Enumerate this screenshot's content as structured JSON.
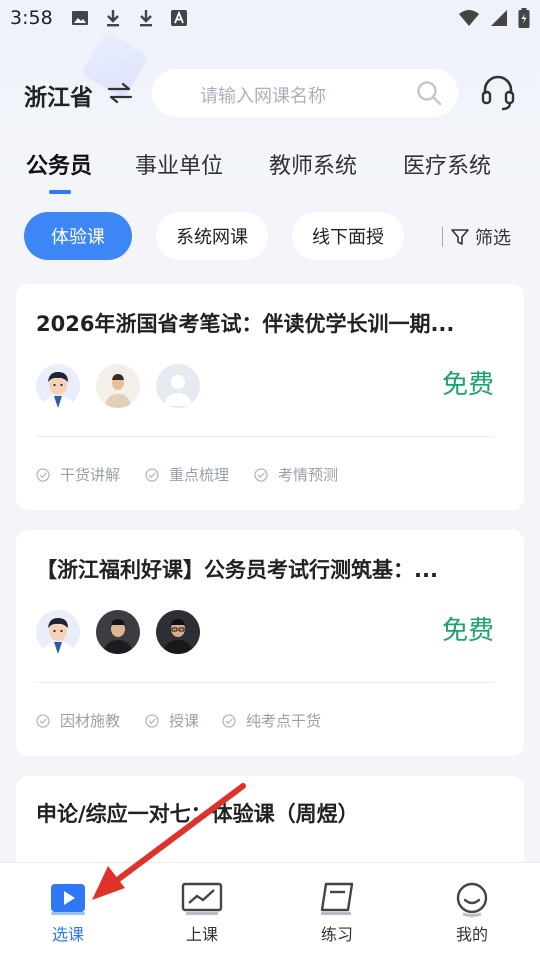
{
  "status_bar": {
    "time": "3:58",
    "notif_icons": [
      "image-icon",
      "download-icon",
      "download-icon",
      "font-icon"
    ]
  },
  "header": {
    "province": "浙江省",
    "search_placeholder": "请输入网课名称"
  },
  "tabs": [
    {
      "label": "公务员",
      "active": true
    },
    {
      "label": "事业单位",
      "active": false
    },
    {
      "label": "教师系统",
      "active": false
    },
    {
      "label": "医疗系统",
      "active": false
    }
  ],
  "chips": [
    {
      "label": "体验课",
      "active": true
    },
    {
      "label": "系统网课",
      "active": false
    },
    {
      "label": "线下面授",
      "active": false
    }
  ],
  "filter_label": "筛选",
  "courses": [
    {
      "title": "2026年浙国省考笔试：伴读优学长训一期...",
      "price": "免费",
      "tags": [
        "干货讲解",
        "重点梳理",
        "考情预测"
      ]
    },
    {
      "title": "【浙江福利好课】公务员考试行测筑基：...",
      "price": "免费",
      "tags": [
        "因材施教",
        "授课",
        "纯考点干货"
      ]
    },
    {
      "title": "申论/综应一对七：体验课（周煜）"
    }
  ],
  "tabbar": [
    {
      "label": "选课",
      "icon": "play-course-icon",
      "active": true
    },
    {
      "label": "上课",
      "icon": "chart-screen-icon",
      "active": false
    },
    {
      "label": "练习",
      "icon": "notebook-icon",
      "active": false
    },
    {
      "label": "我的",
      "icon": "smile-icon",
      "active": false
    }
  ],
  "colors": {
    "accent": "#3d86f5",
    "price": "#1aa36c",
    "arrow": "#e0312b"
  }
}
